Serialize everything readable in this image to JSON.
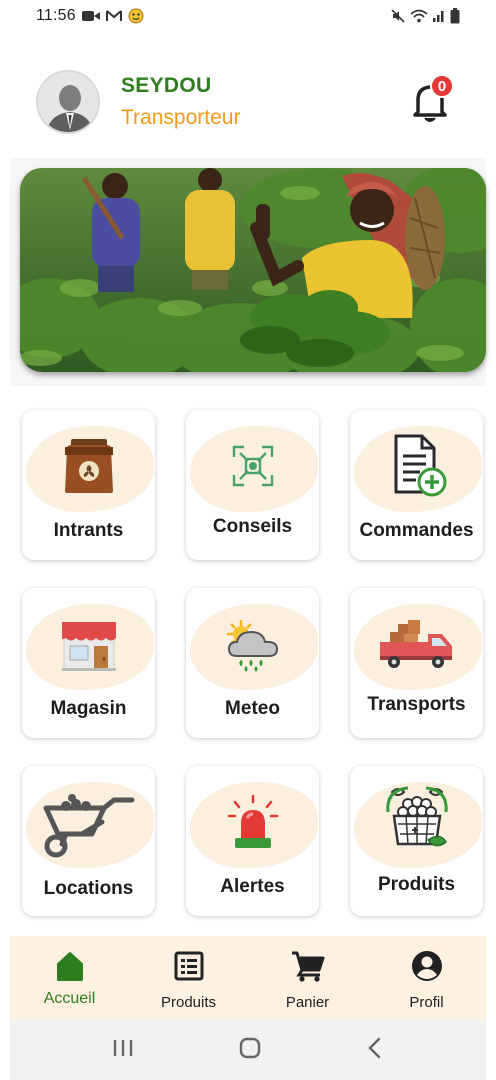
{
  "status_bar": {
    "time": "11:56",
    "icons_left": [
      "video-icon",
      "gmail-icon",
      "emoji-icon"
    ],
    "icons_right": [
      "mute-icon",
      "wifi-icon",
      "signal-icon",
      "battery-icon"
    ]
  },
  "header": {
    "user_name": "SEYDOU",
    "user_role": "Transporteur",
    "notification_count": "0",
    "colors": {
      "name": "#2e7d1f",
      "role": "#f39a1b",
      "badge": "#e53935"
    }
  },
  "banner": {
    "image": "farmers-in-field-photo"
  },
  "menu": {
    "items": [
      {
        "label": "Intrants",
        "icon": "seed-bag-icon"
      },
      {
        "label": "Conseils",
        "icon": "advice-target-icon"
      },
      {
        "label": "Commandes",
        "icon": "add-order-document-icon"
      },
      {
        "label": "Magasin",
        "icon": "store-icon"
      },
      {
        "label": "Meteo",
        "icon": "weather-icon"
      },
      {
        "label": "Transports",
        "icon": "delivery-truck-icon"
      },
      {
        "label": "Locations",
        "icon": "wheelbarrow-icon"
      },
      {
        "label": "Alertes",
        "icon": "siren-icon"
      },
      {
        "label": "Produits",
        "icon": "produce-basket-icon"
      }
    ]
  },
  "bottom_nav": {
    "items": [
      {
        "label": "Accueil",
        "icon": "home-icon",
        "active": true
      },
      {
        "label": "Produits",
        "icon": "list-icon",
        "active": false
      },
      {
        "label": "Panier",
        "icon": "cart-icon",
        "active": false
      },
      {
        "label": "Profil",
        "icon": "account-circle-icon",
        "active": false
      }
    ]
  },
  "system_nav": {
    "buttons": [
      "recents-button",
      "home-button",
      "back-button"
    ]
  }
}
